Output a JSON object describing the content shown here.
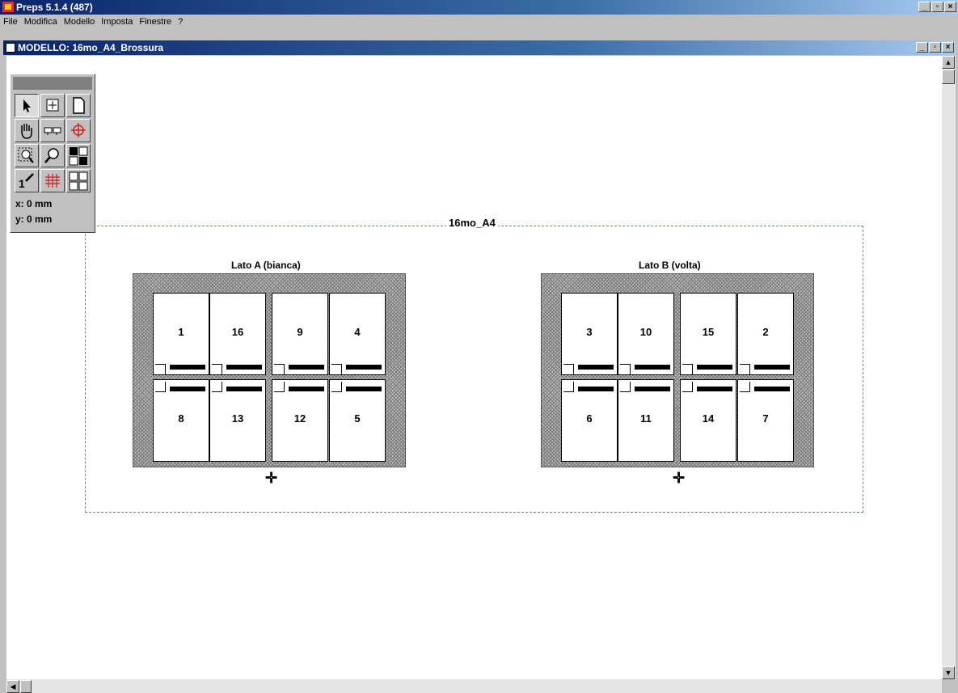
{
  "app": {
    "title": "Preps 5.1.4 (487)",
    "window_buttons": [
      "_",
      "▫",
      "×"
    ]
  },
  "menu": {
    "items": [
      "File",
      "Modifica",
      "Modello",
      "Imposta",
      "Finestre",
      "?"
    ]
  },
  "document": {
    "title": "MODELLO: 16mo_A4_Brossura"
  },
  "palette": {
    "tools": [
      "pointer-icon",
      "move-icon",
      "page-icon",
      "hand-icon",
      "pair-icon",
      "registration-mark-icon",
      "zoom-area-icon",
      "zoom-icon",
      "fold-cross-icon",
      "page-number-icon",
      "grid-icon",
      "imposition-icon"
    ],
    "selected_tool": "pointer-icon",
    "x_readout": "x: 0 mm",
    "y_readout": "y: 0 mm"
  },
  "layout": {
    "name": "16mo_A4",
    "sides": [
      {
        "label": "Lato A (bianca)",
        "top_row": [
          "1",
          "16",
          "9",
          "4"
        ],
        "bottom_row": [
          "8",
          "13",
          "12",
          "5"
        ]
      },
      {
        "label": "Lato B (volta)",
        "top_row": [
          "3",
          "10",
          "15",
          "2"
        ],
        "bottom_row": [
          "6",
          "11",
          "14",
          "7"
        ]
      }
    ]
  },
  "colors": {
    "title_bar": "#0a246a",
    "layout_border": "#4aa24a",
    "canvas": "#ffffff"
  }
}
